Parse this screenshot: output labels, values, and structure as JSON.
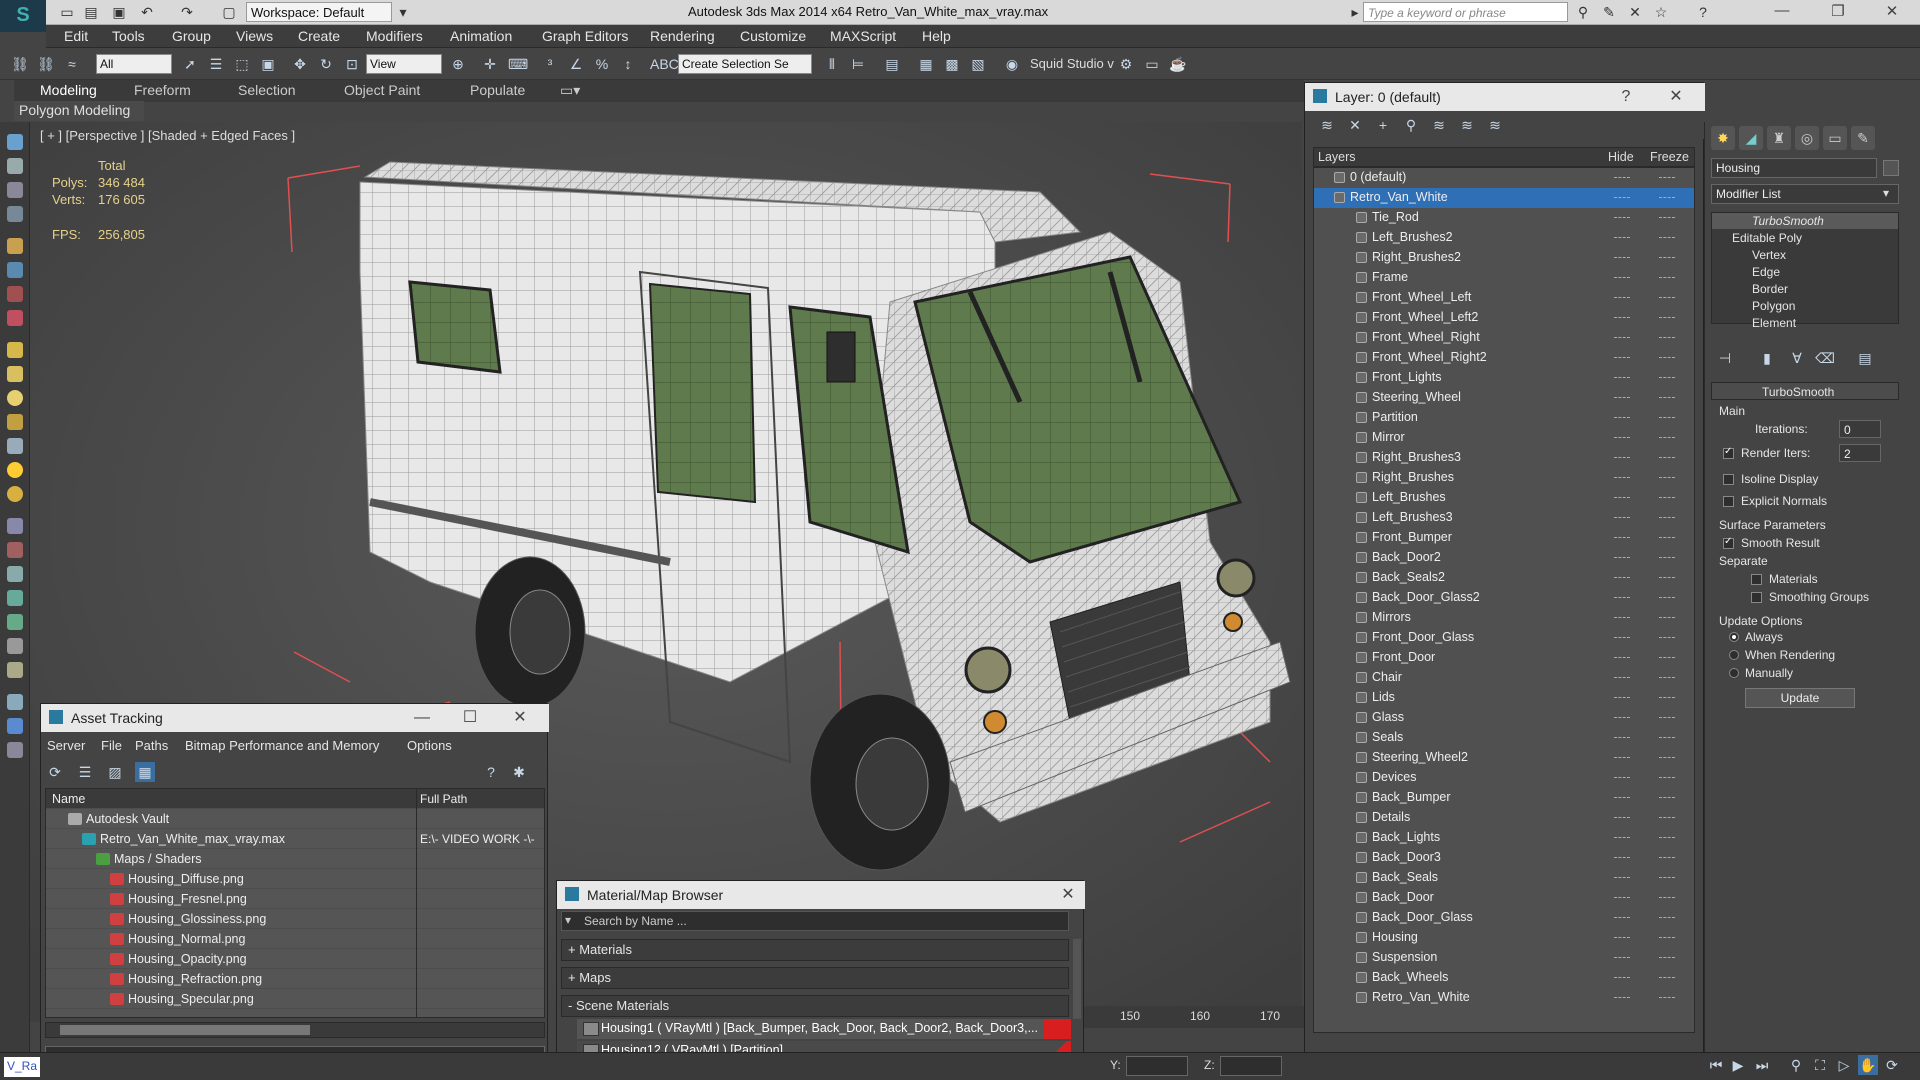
{
  "window": {
    "title": "Autodesk 3ds Max  2014 x64     Retro_Van_White_max_vray.max",
    "workspace": "Workspace: Default",
    "search_placeholder": "Type a keyword or phrase"
  },
  "menu": [
    "Edit",
    "Tools",
    "Group",
    "Views",
    "Create",
    "Modifiers",
    "Animation",
    "Graph Editors",
    "Rendering",
    "Customize",
    "MAXScript",
    "Help"
  ],
  "toolbar": {
    "filter_select": "All",
    "view_select": "View",
    "selection_set": "Create Selection Se",
    "squid": "Squid Studio v"
  },
  "ribbon": {
    "tabs": [
      "Modeling",
      "Freeform",
      "Selection",
      "Object Paint",
      "Populate"
    ],
    "panel": "Polygon Modeling"
  },
  "viewport": {
    "label": "[ + ] [Perspective ] [Shaded + Edged Faces ]",
    "stats": {
      "total_label": "Total",
      "polys_label": "Polys:",
      "polys_value": "346 484",
      "verts_label": "Verts:",
      "verts_value": "176 605",
      "fps_label": "FPS:",
      "fps_value": "256,805"
    }
  },
  "layer_dialog": {
    "title": "Layer: 0 (default)",
    "col_layers": "Layers",
    "col_hide": "Hide",
    "col_freeze": "Freeze",
    "layers": [
      {
        "name": "0 (default)",
        "level": 0
      },
      {
        "name": "Retro_Van_White",
        "level": 0,
        "selected": true
      },
      {
        "name": "Tie_Rod",
        "level": 1
      },
      {
        "name": "Left_Brushes2",
        "level": 1
      },
      {
        "name": "Right_Brushes2",
        "level": 1
      },
      {
        "name": "Frame",
        "level": 1
      },
      {
        "name": "Front_Wheel_Left",
        "level": 1
      },
      {
        "name": "Front_Wheel_Left2",
        "level": 1
      },
      {
        "name": "Front_Wheel_Right",
        "level": 1
      },
      {
        "name": "Front_Wheel_Right2",
        "level": 1
      },
      {
        "name": "Front_Lights",
        "level": 1
      },
      {
        "name": "Steering_Wheel",
        "level": 1
      },
      {
        "name": "Partition",
        "level": 1
      },
      {
        "name": "Mirror",
        "level": 1
      },
      {
        "name": "Right_Brushes3",
        "level": 1
      },
      {
        "name": "Right_Brushes",
        "level": 1
      },
      {
        "name": "Left_Brushes",
        "level": 1
      },
      {
        "name": "Left_Brushes3",
        "level": 1
      },
      {
        "name": "Front_Bumper",
        "level": 1
      },
      {
        "name": "Back_Door2",
        "level": 1
      },
      {
        "name": "Back_Seals2",
        "level": 1
      },
      {
        "name": "Back_Door_Glass2",
        "level": 1
      },
      {
        "name": "Mirrors",
        "level": 1
      },
      {
        "name": "Front_Door_Glass",
        "level": 1
      },
      {
        "name": "Front_Door",
        "level": 1
      },
      {
        "name": "Chair",
        "level": 1
      },
      {
        "name": "Lids",
        "level": 1
      },
      {
        "name": "Glass",
        "level": 1
      },
      {
        "name": "Seals",
        "level": 1
      },
      {
        "name": "Steering_Wheel2",
        "level": 1
      },
      {
        "name": "Devices",
        "level": 1
      },
      {
        "name": "Back_Bumper",
        "level": 1
      },
      {
        "name": "Details",
        "level": 1
      },
      {
        "name": "Back_Lights",
        "level": 1
      },
      {
        "name": "Back_Door3",
        "level": 1
      },
      {
        "name": "Back_Seals",
        "level": 1
      },
      {
        "name": "Back_Door",
        "level": 1
      },
      {
        "name": "Back_Door_Glass",
        "level": 1
      },
      {
        "name": "Housing",
        "level": 1
      },
      {
        "name": "Suspension",
        "level": 1
      },
      {
        "name": "Back_Wheels",
        "level": 1
      },
      {
        "name": "Retro_Van_White",
        "level": 1
      }
    ]
  },
  "command_panel": {
    "object_name": "Housing",
    "modifier_list": "Modifier List",
    "stack": [
      "TurboSmooth",
      "Editable Poly",
      "Vertex",
      "Edge",
      "Border",
      "Polygon",
      "Element"
    ],
    "rollout_title": "TurboSmooth",
    "main_label": "Main",
    "iterations_label": "Iterations:",
    "iterations_value": "0",
    "render_iters_label": "Render Iters:",
    "render_iters_value": "2",
    "isoline": "Isoline Display",
    "explicit_normals": "Explicit Normals",
    "surface_params": "Surface Parameters",
    "smooth_result": "Smooth Result",
    "separate": "Separate",
    "materials": "Materials",
    "smoothing_groups": "Smoothing Groups",
    "update_options": "Update Options",
    "always": "Always",
    "when_rendering": "When Rendering",
    "manually": "Manually",
    "update_btn": "Update"
  },
  "asset_tracking": {
    "title": "Asset Tracking",
    "menu": [
      "Server",
      "File",
      "Paths",
      "Bitmap Performance and Memory",
      "Options"
    ],
    "col_name": "Name",
    "col_path": "Full Path",
    "rows": [
      {
        "name": "Autodesk Vault",
        "indent": 1,
        "path": ""
      },
      {
        "name": "Retro_Van_White_max_vray.max",
        "indent": 2,
        "path": "E:\\- VIDEO WORK -\\-"
      },
      {
        "name": "Maps / Shaders",
        "indent": 3,
        "path": ""
      },
      {
        "name": "Housing_Diffuse.png",
        "indent": 4,
        "path": ""
      },
      {
        "name": "Housing_Fresnel.png",
        "indent": 4,
        "path": ""
      },
      {
        "name": "Housing_Glossiness.png",
        "indent": 4,
        "path": ""
      },
      {
        "name": "Housing_Normal.png",
        "indent": 4,
        "path": ""
      },
      {
        "name": "Housing_Opacity.png",
        "indent": 4,
        "path": ""
      },
      {
        "name": "Housing_Refraction.png",
        "indent": 4,
        "path": ""
      },
      {
        "name": "Housing_Specular.png",
        "indent": 4,
        "path": ""
      }
    ]
  },
  "material_browser": {
    "title": "Material/Map Browser",
    "search_placeholder": "Search by Name ...",
    "sections": [
      "+ Materials",
      "+ Maps",
      "- Scene Materials"
    ],
    "items": [
      "Housing1  ( VRayMtl ) [Back_Bumper, Back_Door, Back_Door2, Back_Door3,...",
      "Housing12  ( VRayMtl ) [Partition]"
    ]
  },
  "timeline": {
    "ticks": [
      "150",
      "160",
      "170"
    ]
  },
  "status": {
    "y_label": "Y:",
    "z_label": "Z:",
    "script_box": "V_Ra"
  }
}
